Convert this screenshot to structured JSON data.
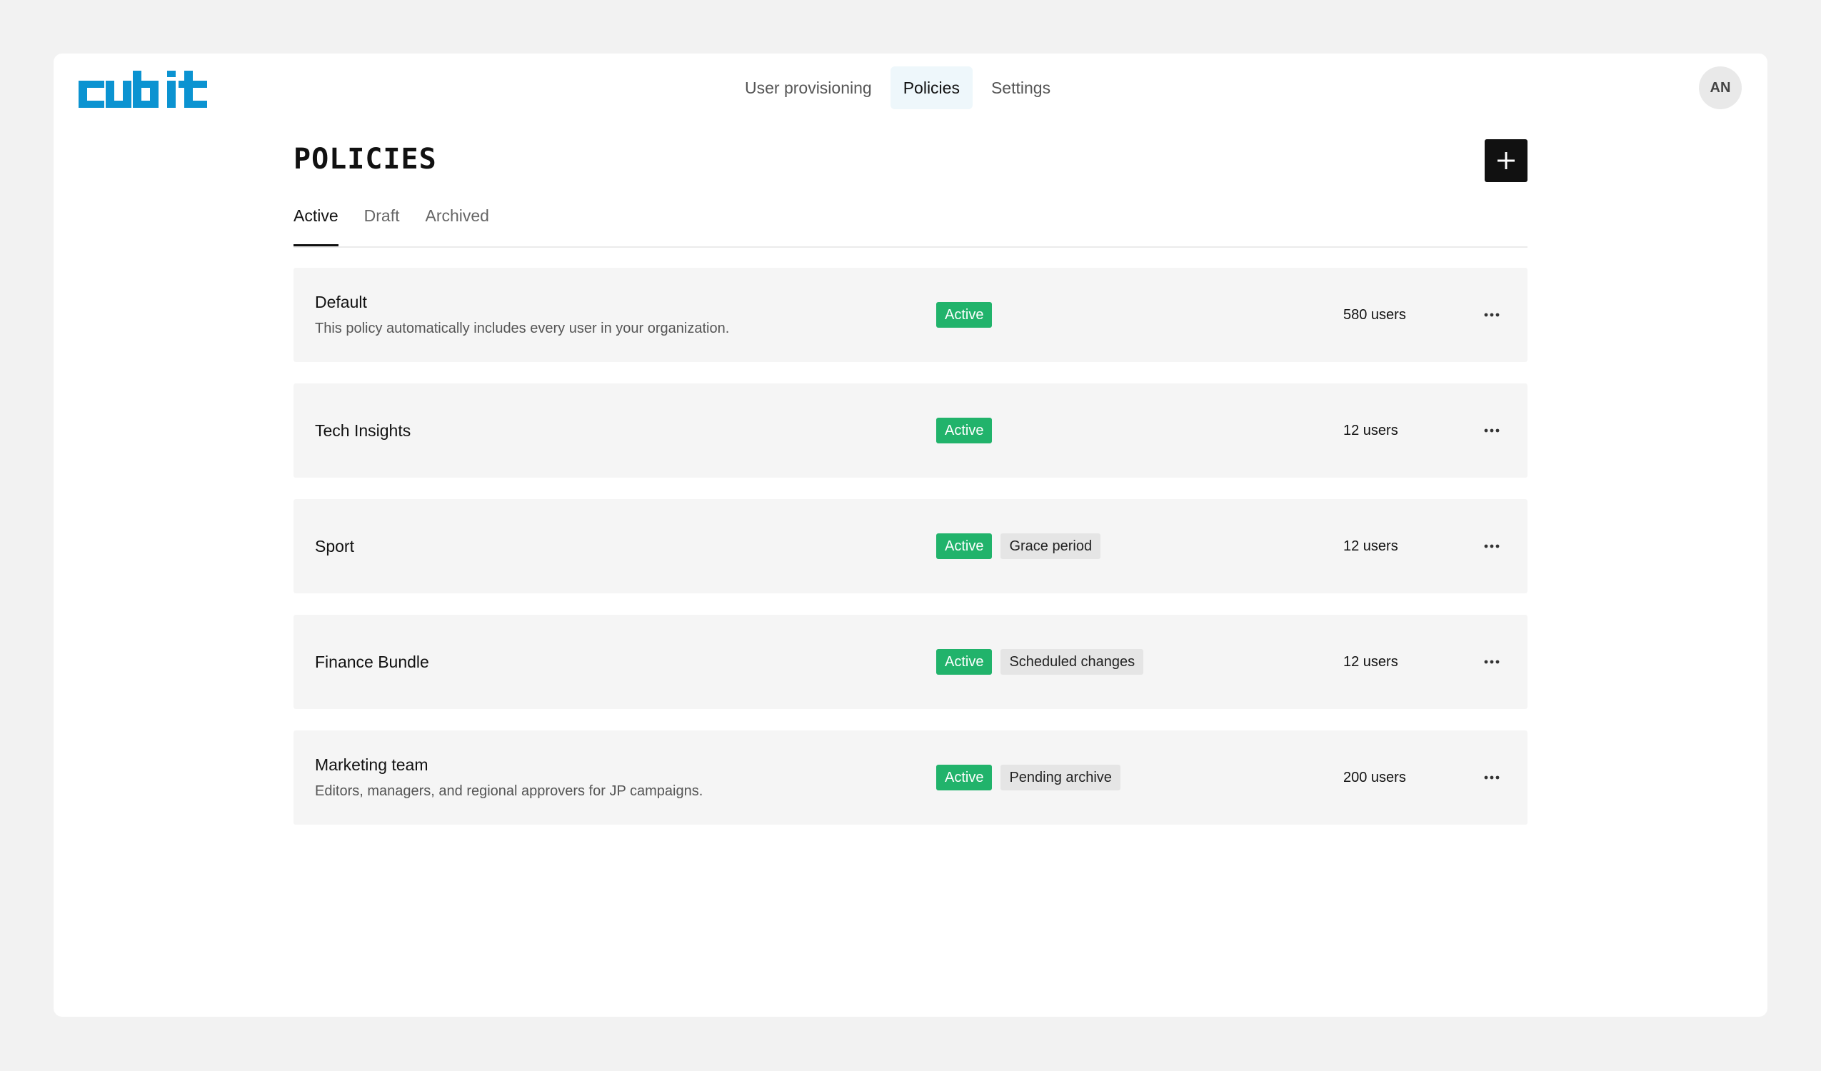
{
  "brand": {
    "logo_text": "cubit",
    "color": "#0b93d1"
  },
  "nav": {
    "items": [
      {
        "label": "User provisioning"
      },
      {
        "label": "Policies"
      },
      {
        "label": "Settings"
      }
    ],
    "active": "Policies"
  },
  "user": {
    "initials": "AN"
  },
  "page": {
    "title": "POLICIES",
    "add_icon": "plus-icon"
  },
  "tabs": [
    {
      "label": "Active"
    },
    {
      "label": "Draft"
    },
    {
      "label": "Archived"
    }
  ],
  "policies": [
    {
      "name": "Default",
      "description": "This policy automatically includes every user in your organization.",
      "status": "Active",
      "extra_badge": "",
      "users": "580 users"
    },
    {
      "name": "Tech Insights",
      "description": "",
      "status": "Active",
      "extra_badge": "",
      "users": "12 users"
    },
    {
      "name": "Sport",
      "description": "",
      "status": "Active",
      "extra_badge": "Grace period",
      "users": "12 users"
    },
    {
      "name": "Finance Bundle",
      "description": "",
      "status": "Active",
      "extra_badge": "Scheduled changes",
      "users": "12 users"
    },
    {
      "name": "Marketing team",
      "description": "Editors, managers, and regional approvers for JP campaigns.",
      "status": "Active",
      "extra_badge": "Pending archive",
      "users": "200 users"
    }
  ],
  "colors": {
    "active_badge": "#21b36b",
    "gray_badge": "#e5e5e5",
    "nav_active_bg": "#eef7fb"
  }
}
